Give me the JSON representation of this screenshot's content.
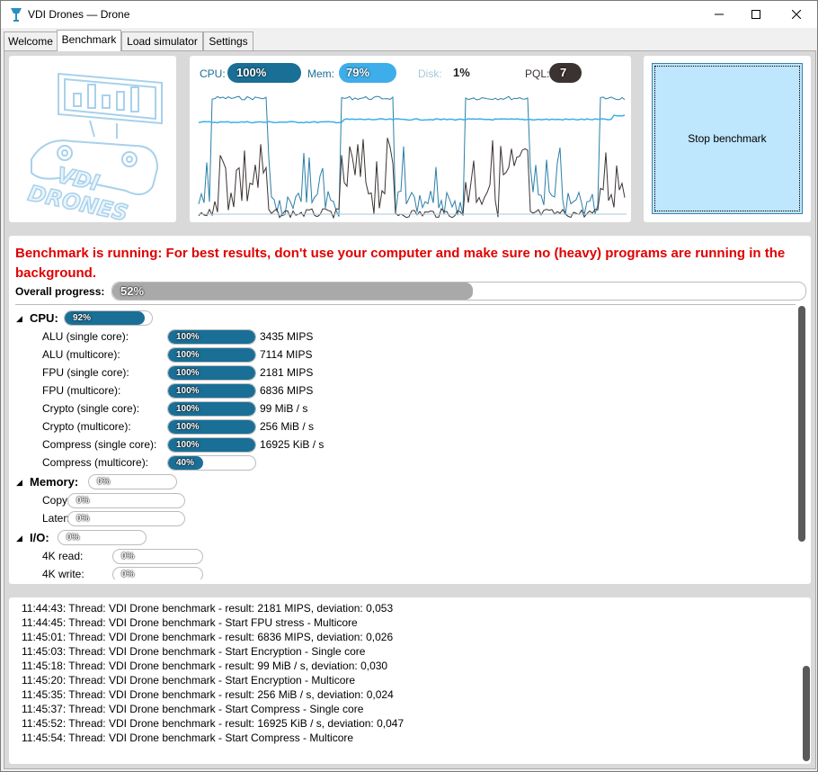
{
  "window": {
    "title": "VDI Drones — Drone"
  },
  "tabs": [
    {
      "label": "Welcome"
    },
    {
      "label": "Benchmark"
    },
    {
      "label": "Load simulator"
    },
    {
      "label": "Settings"
    }
  ],
  "active_tab": "Benchmark",
  "logo": {
    "line1": "VDI",
    "line2": "DRONES"
  },
  "stats": {
    "cpu_label": "CPU:",
    "cpu_value": "100%",
    "mem_label": "Mem:",
    "mem_value": "79%",
    "disk_label": "Disk:",
    "disk_value": "1%",
    "pql_label": "PQL:",
    "pql_value": "7"
  },
  "stop_button": {
    "label": "Stop benchmark"
  },
  "warning": "Benchmark is running: For best results, don't use your computer and make sure no (heavy) programs are running in the background.",
  "overall": {
    "label": "Overall progress:",
    "text": "52%",
    "fraction": 0.52
  },
  "groups": {
    "cpu": {
      "label": "CPU:",
      "text": "92%",
      "fraction": 0.92
    },
    "memory": {
      "label": "Memory:",
      "text": "0%",
      "fraction": 0
    },
    "io": {
      "label": "I/O:",
      "text": "0%",
      "fraction": 0
    }
  },
  "cpu_items": [
    {
      "label": "ALU (single core):",
      "text": "100%",
      "fraction": 1.0,
      "value": "3435 MIPS"
    },
    {
      "label": "ALU (multicore):",
      "text": "100%",
      "fraction": 1.0,
      "value": "7114 MIPS"
    },
    {
      "label": "FPU (single core):",
      "text": "100%",
      "fraction": 1.0,
      "value": "2181 MIPS"
    },
    {
      "label": "FPU (multicore):",
      "text": "100%",
      "fraction": 1.0,
      "value": "6836 MIPS"
    },
    {
      "label": "Crypto (single core):",
      "text": "100%",
      "fraction": 1.0,
      "value": "99 MiB / s"
    },
    {
      "label": "Crypto (multicore):",
      "text": "100%",
      "fraction": 1.0,
      "value": "256 MiB / s"
    },
    {
      "label": "Compress (single core):",
      "text": "100%",
      "fraction": 1.0,
      "value": "16925 KiB / s"
    },
    {
      "label": "Compress (multicore):",
      "text": "40%",
      "fraction": 0.4,
      "value": ""
    }
  ],
  "memory_items": [
    {
      "label": "Copy:",
      "text": "0%",
      "fraction": 0
    },
    {
      "label": "Latency:",
      "text": "0%",
      "fraction": 0
    }
  ],
  "io_items": [
    {
      "label": "4K read:",
      "text": "0%",
      "fraction": 0
    },
    {
      "label": "4K write:",
      "text": "0%",
      "fraction": 0
    }
  ],
  "log": [
    "11:44:43: Thread: VDI Drone benchmark - result: 2181 MIPS, deviation: 0,053",
    "11:44:45: Thread: VDI Drone benchmark - Start FPU stress - Multicore",
    "11:45:01: Thread: VDI Drone benchmark - result: 6836 MIPS, deviation: 0,026",
    "11:45:03: Thread: VDI Drone benchmark - Start Encryption - Single core",
    "11:45:18: Thread: VDI Drone benchmark - result: 99 MiB / s, deviation: 0,030",
    "11:45:20: Thread: VDI Drone benchmark - Start Encryption - Multicore",
    "11:45:35: Thread: VDI Drone benchmark - result: 256 MiB / s, deviation: 0,024",
    "11:45:37: Thread: VDI Drone benchmark - Start Compress - Single core",
    "11:45:52: Thread: VDI Drone benchmark - result: 16925 KiB / s, deviation: 0,047",
    "11:45:54: Thread: VDI Drone benchmark - Start Compress - Multicore"
  ],
  "colors": {
    "cpu": "#1a6f96",
    "mem": "#3daee9",
    "disk_text": "#a7c8da",
    "pql": "#3b3331",
    "warning": "#e00000",
    "overall_fill": "#a9a9a9",
    "bar_fill": "#1a6f96",
    "stop_bg": "#bee6fd"
  }
}
